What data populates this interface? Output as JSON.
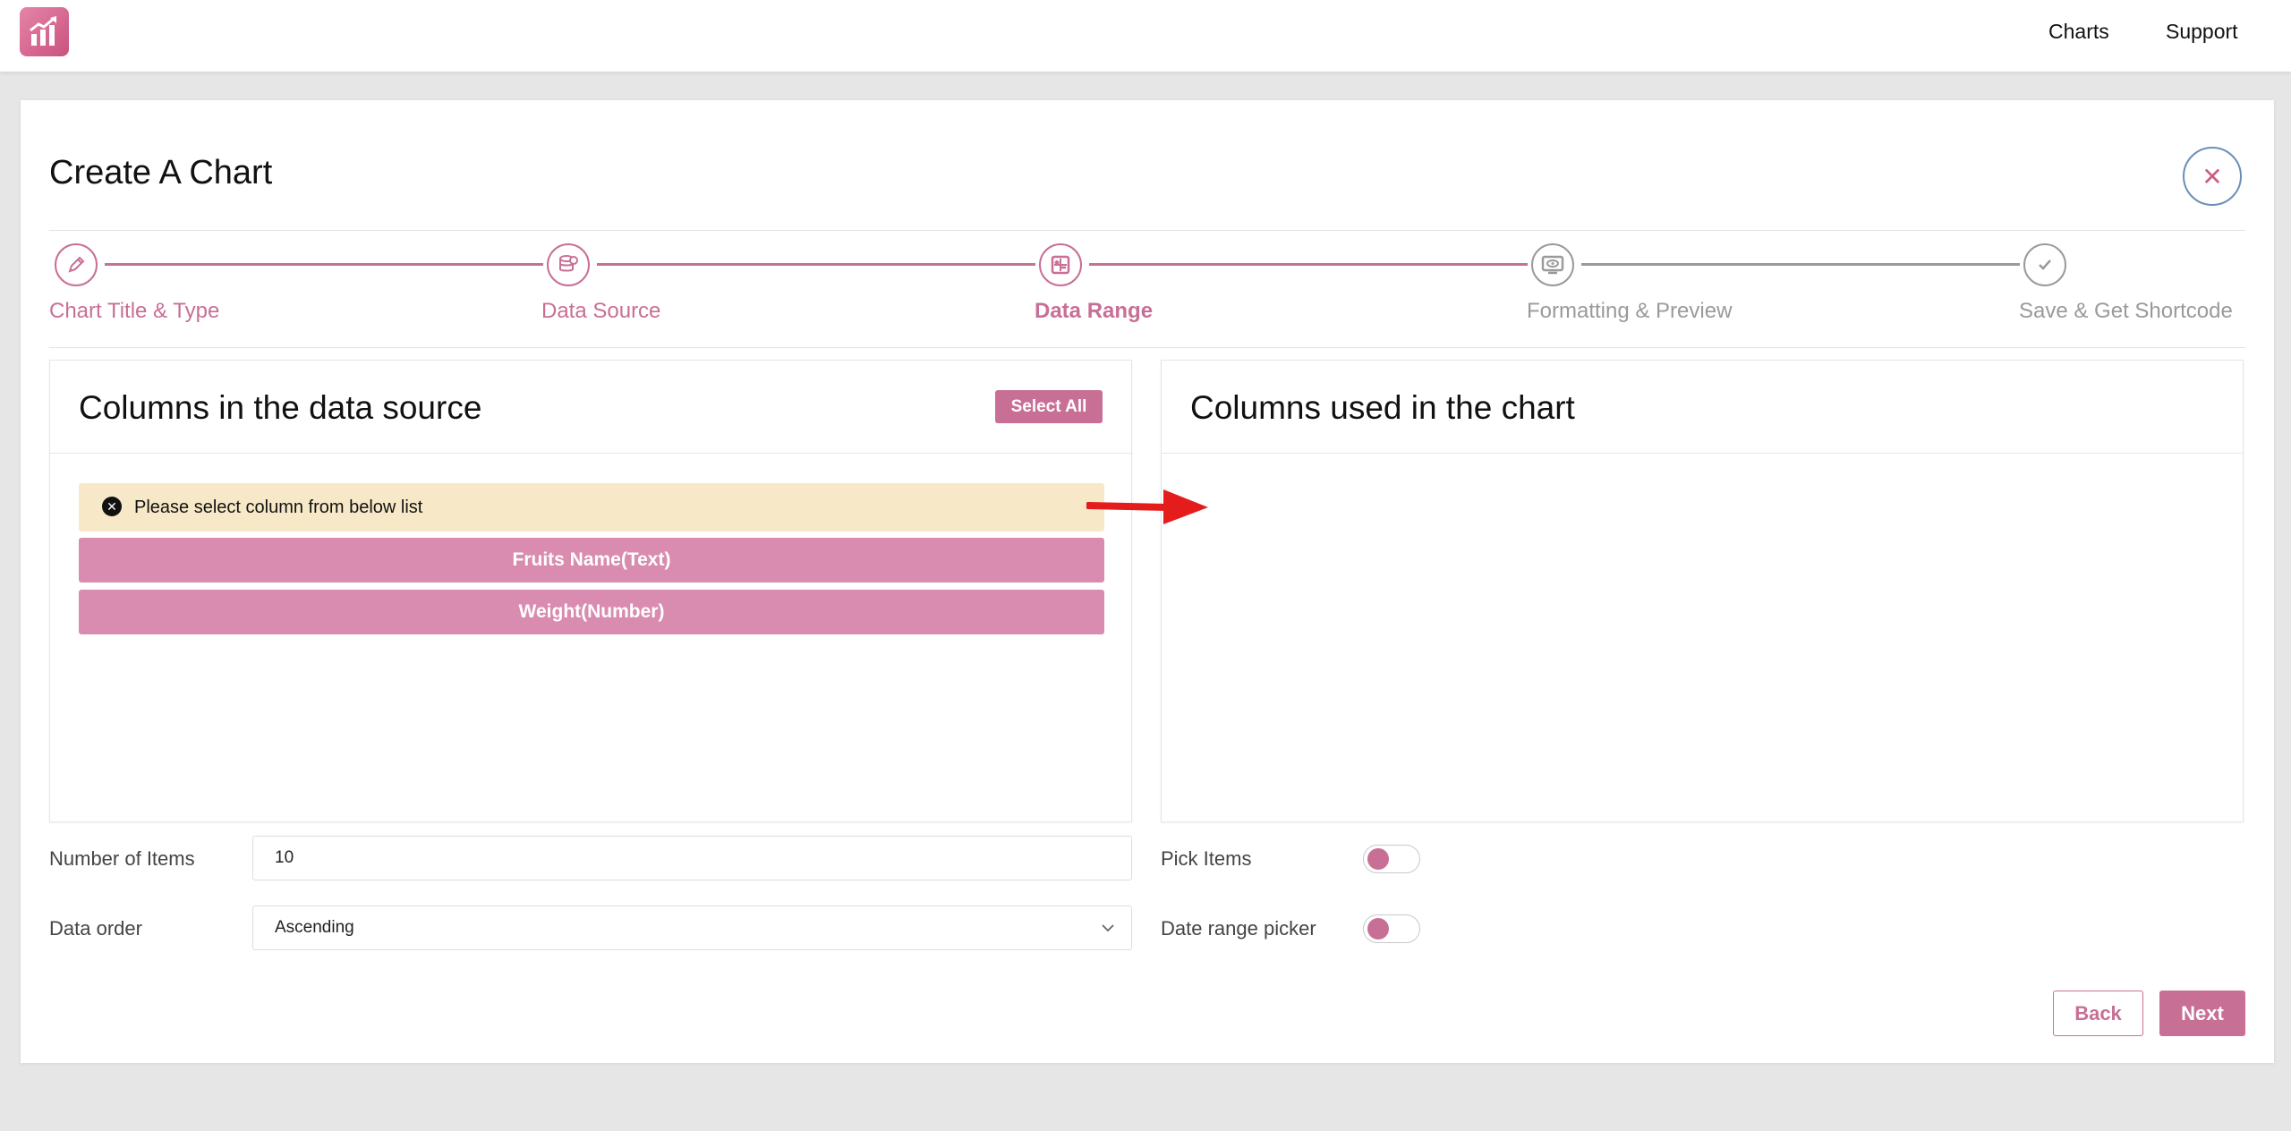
{
  "topbar": {
    "logo_icon": "bar-chart-trending-icon",
    "nav": [
      {
        "label": "Charts"
      },
      {
        "label": "Support"
      }
    ]
  },
  "page": {
    "title": "Create A Chart",
    "close_icon": "close-icon"
  },
  "stepper": {
    "steps": [
      {
        "label": "Chart Title & Type",
        "icon": "pencil-icon",
        "state": "completed"
      },
      {
        "label": "Data Source",
        "icon": "database-icon",
        "state": "completed"
      },
      {
        "label": "Data Range",
        "icon": "range-icon",
        "state": "active"
      },
      {
        "label": "Formatting & Preview",
        "icon": "preview-icon",
        "state": "pending"
      },
      {
        "label": "Save & Get Shortcode",
        "icon": "check-icon",
        "state": "pending"
      }
    ],
    "colors": {
      "done": "#c86f96",
      "pending": "#9a9a9a"
    }
  },
  "source_panel": {
    "title": "Columns in the data source",
    "select_all_label": "Select All",
    "alert_text": "Please select column from below list",
    "columns": [
      {
        "label": "Fruits Name(Text)"
      },
      {
        "label": "Weight(Number)"
      }
    ]
  },
  "chart_panel": {
    "title": "Columns used in the chart",
    "columns": []
  },
  "form": {
    "number_of_items": {
      "label": "Number of Items",
      "value": "10"
    },
    "data_order": {
      "label": "Data order",
      "value": "Ascending"
    },
    "pick_items": {
      "label": "Pick Items",
      "enabled": false
    },
    "date_range_picker": {
      "label": "Date range picker",
      "enabled": false
    }
  },
  "actions": {
    "back_label": "Back",
    "next_label": "Next"
  },
  "colors": {
    "accent": "#c86f96",
    "column_item": "#d98cb0",
    "alert_bg": "#f7e9c8"
  }
}
